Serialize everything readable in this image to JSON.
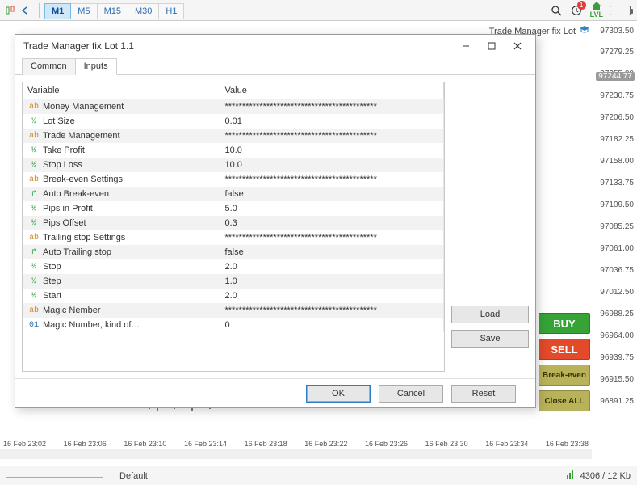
{
  "toolbar": {
    "timeframes": [
      "M1",
      "M5",
      "M15",
      "M30",
      "H1"
    ],
    "active_tf_index": 0,
    "notification_count": "1",
    "lvl_label": "LVL"
  },
  "ea_label": "Trade Manager fix Lot",
  "price_axis": {
    "ticks": [
      "97303.50",
      "97279.25",
      "97255.00",
      "97230.75",
      "97206.50",
      "97182.25",
      "97158.00",
      "97133.75",
      "97109.50",
      "97085.25",
      "97061.00",
      "97036.75",
      "97012.50",
      "96988.25",
      "96964.00",
      "96939.75",
      "96915.50",
      "96891.25"
    ],
    "highlight": "97244.77"
  },
  "action_buttons": {
    "buy": "BUY",
    "sell": "SELL",
    "be": "Break-even",
    "close": "Close ALL"
  },
  "time_axis": [
    "16 Feb 23:02",
    "16 Feb 23:06",
    "16 Feb 23:10",
    "16 Feb 23:14",
    "16 Feb 23:18",
    "16 Feb 23:22",
    "16 Feb 23:26",
    "16 Feb 23:30",
    "16 Feb 23:34",
    "16 Feb 23:38"
  ],
  "status_bar": {
    "profile": "Default",
    "traffic": "4306 / 12 Kb"
  },
  "dialog": {
    "title": "Trade Manager fix Lot 1.1",
    "tabs": {
      "common": "Common",
      "inputs": "Inputs"
    },
    "headers": {
      "variable": "Variable",
      "value": "Value"
    },
    "rows": [
      {
        "icon": "ab",
        "name": "Money Management",
        "value": "********************************************"
      },
      {
        "icon": "half",
        "name": "Lot Size",
        "value": "0.01"
      },
      {
        "icon": "ab",
        "name": "Trade Management",
        "value": "********************************************"
      },
      {
        "icon": "half",
        "name": "Take Profit",
        "value": "10.0"
      },
      {
        "icon": "half",
        "name": "Stop Loss",
        "value": "10.0"
      },
      {
        "icon": "ab",
        "name": "Break-even Settings",
        "value": "********************************************"
      },
      {
        "icon": "ret",
        "name": "Auto Break-even",
        "value": "false"
      },
      {
        "icon": "half",
        "name": "Pips in Profit",
        "value": "5.0"
      },
      {
        "icon": "half",
        "name": "Pips Offset",
        "value": "0.3"
      },
      {
        "icon": "ab",
        "name": "Trailing stop Settings",
        "value": "********************************************"
      },
      {
        "icon": "ret",
        "name": "Auto Trailing stop",
        "value": "false"
      },
      {
        "icon": "half",
        "name": "Stop",
        "value": "2.0"
      },
      {
        "icon": "half",
        "name": "Step",
        "value": "1.0"
      },
      {
        "icon": "half",
        "name": "Start",
        "value": "2.0"
      },
      {
        "icon": "ab",
        "name": "Magic Nember",
        "value": "********************************************"
      },
      {
        "icon": "oi",
        "name": "Magic Number, kind of…",
        "value": "0"
      }
    ],
    "side": {
      "load": "Load",
      "save": "Save"
    },
    "footer": {
      "ok": "OK",
      "cancel": "Cancel",
      "reset": "Reset"
    }
  }
}
